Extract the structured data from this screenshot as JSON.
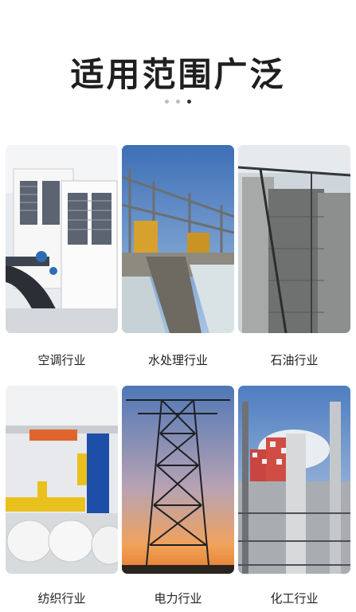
{
  "page": {
    "title": "适用范围广泛",
    "carousel_indicator": {
      "count": 3,
      "active_index": 2
    }
  },
  "industries": [
    {
      "label": "空调行业",
      "icon": "hvac-units-photo"
    },
    {
      "label": "水处理行业",
      "icon": "dam-water-photo"
    },
    {
      "label": "石油行业",
      "icon": "silo-tanks-photo"
    },
    {
      "label": "纺织行业",
      "icon": "textile-factory-photo"
    },
    {
      "label": "电力行业",
      "icon": "power-tower-photo"
    },
    {
      "label": "化工行业",
      "icon": "chemical-plant-photo"
    }
  ],
  "colors": {
    "title": "#1f1f1f",
    "caption": "#222222",
    "dot": "#bdbdbd",
    "dot_active": "#333333"
  }
}
